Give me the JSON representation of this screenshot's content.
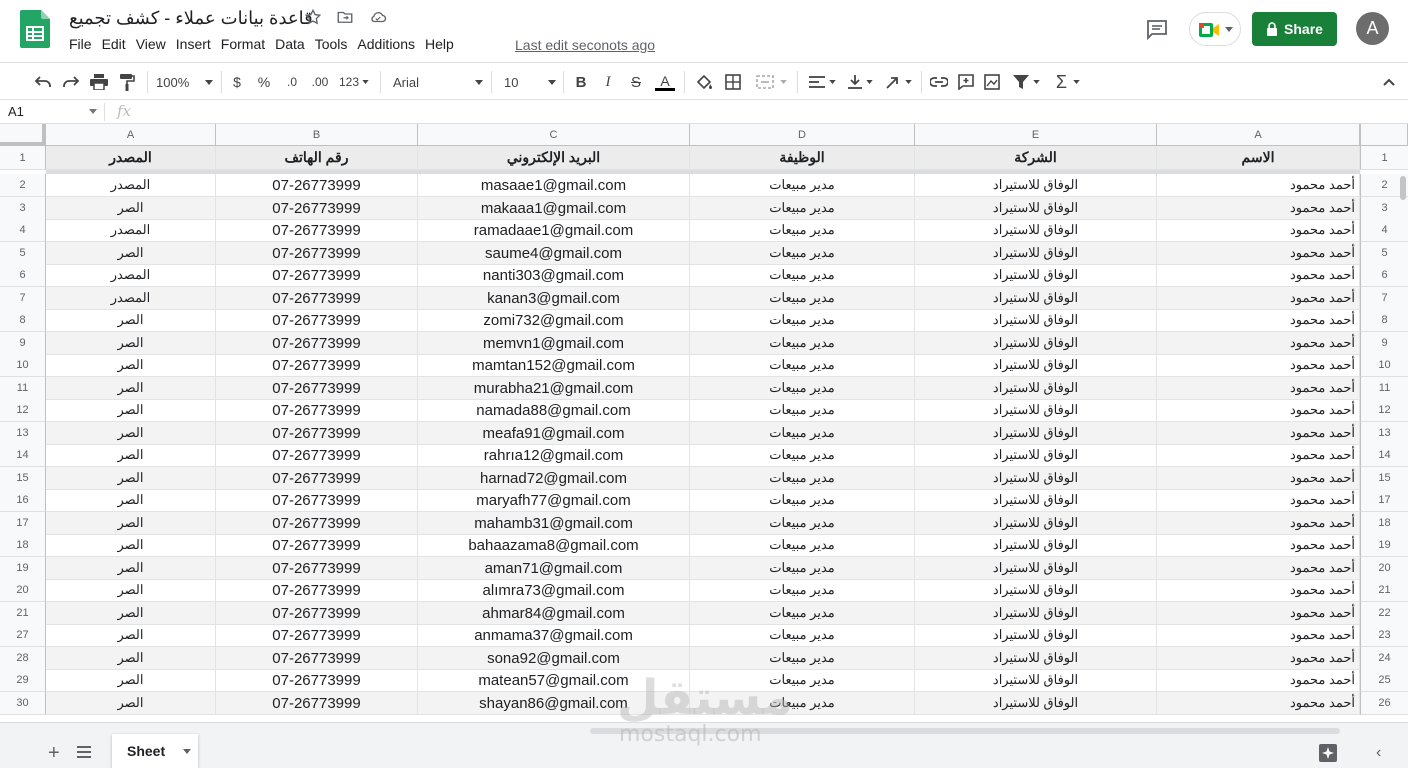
{
  "app": {
    "title": "قاعدة بيانات عملاء - كشف تجميع",
    "last_edit": "Last edit seconots ago",
    "share_label": "Share",
    "avatar_initial": "A"
  },
  "menu": [
    "File",
    "Edit",
    "View",
    "Insert",
    "Format",
    "Data",
    "Tools",
    "Additions",
    "Help"
  ],
  "toolbar": {
    "zoom": "100%",
    "currency": "$",
    "percent": "%",
    "dec_decrease": ".0",
    "dec_increase": ".00",
    "more_formats": "123",
    "font": "Arial",
    "font_size": "10"
  },
  "formula_bar": {
    "cell_ref": "A1",
    "fx": "fx"
  },
  "columns": [
    "A",
    "B",
    "C",
    "D",
    "E",
    "A"
  ],
  "header_row": {
    "row_num": "1",
    "source": "المصدر",
    "phone": "رقم الهاتف",
    "email": "البريد الإلكتروني",
    "job": "الوظيفة",
    "company": "الشركة",
    "name": "الاسم"
  },
  "rows": [
    {
      "left": "2",
      "right": "2",
      "source": "المصدر",
      "phone": "07-26773999",
      "email": "masaae1@gmail.com",
      "job": "مدير مبيعات",
      "company": "الوفاق للاستيراد",
      "name": "أحمد محمود"
    },
    {
      "left": "3",
      "right": "3",
      "source": "الصر",
      "phone": "07-26773999",
      "email": "makaaa1@gmail.com",
      "job": "مدير مبيعات",
      "company": "الوفاق للاستيراد",
      "name": "أحمد محمود"
    },
    {
      "left": "4",
      "right": "4",
      "source": "المصدر",
      "phone": "07-26773999",
      "email": "ramadaae1@gmail.com",
      "job": "مدير مبيعات",
      "company": "الوفاق للاستيراد",
      "name": "أحمد محمود"
    },
    {
      "left": "5",
      "right": "5",
      "source": "الصر",
      "phone": "07-26773999",
      "email": "saume4@gmail.com",
      "job": "مدير مبيعات",
      "company": "الوفاق للاستيراد",
      "name": "أحمد محمود"
    },
    {
      "left": "6",
      "right": "6",
      "source": "المصدر",
      "phone": "07-26773999",
      "email": "nanti303@gmail.com",
      "job": "مدير مبيعات",
      "company": "الوفاق للاستيراد",
      "name": "أحمد محمود"
    },
    {
      "left": "7",
      "right": "7",
      "source": "المصدر",
      "phone": "07-26773999",
      "email": "kanan3@gmail.com",
      "job": "مدير مبيعات",
      "company": "الوفاق للاستيراد",
      "name": "أحمد محمود"
    },
    {
      "left": "8",
      "right": "8",
      "source": "الصر",
      "phone": "07-26773999",
      "email": "zomi732@gmail.com",
      "job": "مدير مبيعات",
      "company": "الوفاق للاستيراد",
      "name": "أحمد محمود"
    },
    {
      "left": "9",
      "right": "9",
      "source": "الصر",
      "phone": "07-26773999",
      "email": "memvn1@gmail.com",
      "job": "مدير مبيعات",
      "company": "الوفاق للاستيراد",
      "name": "أحمد محمود"
    },
    {
      "left": "10",
      "right": "10",
      "source": "الصر",
      "phone": "07-26773999",
      "email": "mamtan152@gmail.com",
      "job": "مدير مبيعات",
      "company": "الوفاق للاستيراد",
      "name": "أحمد محمود"
    },
    {
      "left": "11",
      "right": "11",
      "source": "الصر",
      "phone": "07-26773999",
      "email": "murabha21@gmail.com",
      "job": "مدير مبيعات",
      "company": "الوفاق للاستيراد",
      "name": "أحمد محمود"
    },
    {
      "left": "12",
      "right": "12",
      "source": "الصر",
      "phone": "07-26773999",
      "email": "namada88@gmail.com",
      "job": "مدير مبيعات",
      "company": "الوفاق للاستيراد",
      "name": "أحمد محمود"
    },
    {
      "left": "13",
      "right": "13",
      "source": "الصر",
      "phone": "07-26773999",
      "email": "meafa91@gmail.com",
      "job": "مدير مبيعات",
      "company": "الوفاق للاستيراد",
      "name": "أحمد محمود"
    },
    {
      "left": "14",
      "right": "14",
      "source": "الصر",
      "phone": "07-26773999",
      "email": "rahrıa12@gmail.com",
      "job": "مدير مبيعات",
      "company": "الوفاق للاستيراد",
      "name": "أحمد محمود"
    },
    {
      "left": "15",
      "right": "15",
      "source": "الصر",
      "phone": "07-26773999",
      "email": "harnad72@gmail.com",
      "job": "مدير مبيعات",
      "company": "الوفاق للاستيراد",
      "name": "أحمد محمود"
    },
    {
      "left": "16",
      "right": "17",
      "source": "الصر",
      "phone": "07-26773999",
      "email": "maryafh77@gmail.com",
      "job": "مدير مبيعات",
      "company": "الوفاق للاستيراد",
      "name": "أحمد محمود"
    },
    {
      "left": "17",
      "right": "18",
      "source": "الصر",
      "phone": "07-26773999",
      "email": "mahamb31@gmail.com",
      "job": "مدير مبيعات",
      "company": "الوفاق للاستيراد",
      "name": "أحمد محمود"
    },
    {
      "left": "18",
      "right": "19",
      "source": "الصر",
      "phone": "07-26773999",
      "email": "bahaazama8@gmail.com",
      "job": "مدير مبيعات",
      "company": "الوفاق للاستيراد",
      "name": "أحمد محمود"
    },
    {
      "left": "19",
      "right": "20",
      "source": "الصر",
      "phone": "07-26773999",
      "email": "aman71@gmail.com",
      "job": "مدير مبيعات",
      "company": "الوفاق للاستيراد",
      "name": "أحمد محمود"
    },
    {
      "left": "20",
      "right": "21",
      "source": "الصر",
      "phone": "07-26773999",
      "email": "alımra73@gmail.com",
      "job": "مدير مبيعات",
      "company": "الوفاق للاستيراد",
      "name": "أحمد محمود"
    },
    {
      "left": "21",
      "right": "22",
      "source": "الصر",
      "phone": "07-26773999",
      "email": "ahmar84@gmail.com",
      "job": "مدير مبيعات",
      "company": "الوفاق للاستيراد",
      "name": "أحمد محمود"
    },
    {
      "left": "27",
      "right": "23",
      "source": "الصر",
      "phone": "07-26773999",
      "email": "anmama37@gmail.com",
      "job": "مدير مبيعات",
      "company": "الوفاق للاستيراد",
      "name": "أحمد محمود"
    },
    {
      "left": "28",
      "right": "24",
      "source": "الصر",
      "phone": "07-26773999",
      "email": "sona92@gmail.com",
      "job": "مدير مبيعات",
      "company": "الوفاق للاستيراد",
      "name": "أحمد محمود"
    },
    {
      "left": "29",
      "right": "25",
      "source": "الصر",
      "phone": "07-26773999",
      "email": "matean57@gmail.com",
      "job": "مدير مبيعات",
      "company": "الوفاق للاستيراد",
      "name": "أحمد محمود"
    },
    {
      "left": "30",
      "right": "26",
      "source": "الصر",
      "phone": "07-26773999",
      "email": "shayan86@gmail.com",
      "job": "مدير مبيعات",
      "company": "الوفاق للاستيراد",
      "name": "أحمد محمود"
    }
  ],
  "sheet_tab": "Sheet",
  "watermark": {
    "arabic": "مستقل",
    "latin": "mostaql.com"
  },
  "colors": {
    "share_green": "#188038",
    "header_bg": "#ececec",
    "alt_row": "#f3f3f3"
  }
}
